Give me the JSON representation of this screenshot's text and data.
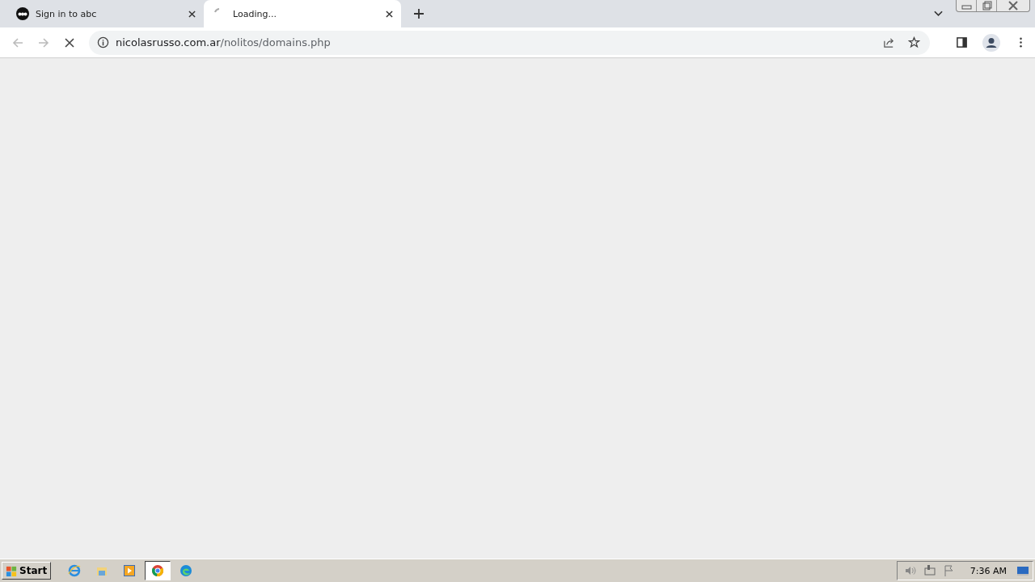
{
  "tabs": [
    {
      "title": "Sign in to abc",
      "selected": false,
      "kind": "logo"
    },
    {
      "title": "Loading...",
      "selected": true,
      "kind": "spinner"
    }
  ],
  "address": {
    "host": "nicolasrusso.com.ar",
    "path": "/nolitos/domains.php"
  },
  "taskbar": {
    "start": "Start",
    "apps": [
      {
        "kind": "ie",
        "selected": false
      },
      {
        "kind": "folder",
        "selected": false
      },
      {
        "kind": "media",
        "selected": false
      },
      {
        "kind": "chrome",
        "selected": true
      },
      {
        "kind": "edge",
        "selected": false
      }
    ],
    "clock": "7:36 AM"
  }
}
